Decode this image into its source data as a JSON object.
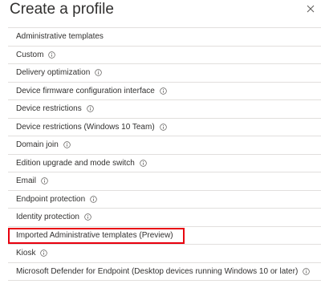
{
  "header": {
    "title": "Create a profile"
  },
  "items": [
    {
      "label": "Administrative templates",
      "info": false,
      "highlighted": false
    },
    {
      "label": "Custom",
      "info": true,
      "highlighted": false
    },
    {
      "label": "Delivery optimization",
      "info": true,
      "highlighted": false
    },
    {
      "label": "Device firmware configuration interface",
      "info": true,
      "highlighted": false
    },
    {
      "label": "Device restrictions",
      "info": true,
      "highlighted": false
    },
    {
      "label": "Device restrictions (Windows 10 Team)",
      "info": true,
      "highlighted": false
    },
    {
      "label": "Domain join",
      "info": true,
      "highlighted": false
    },
    {
      "label": "Edition upgrade and mode switch",
      "info": true,
      "highlighted": false
    },
    {
      "label": "Email",
      "info": true,
      "highlighted": false
    },
    {
      "label": "Endpoint protection",
      "info": true,
      "highlighted": false
    },
    {
      "label": "Identity protection",
      "info": true,
      "highlighted": false
    },
    {
      "label": "Imported Administrative templates (Preview)",
      "info": false,
      "highlighted": true
    },
    {
      "label": "Kiosk",
      "info": true,
      "highlighted": false
    },
    {
      "label": "Microsoft Defender for Endpoint (Desktop devices running Windows 10 or later)",
      "info": true,
      "highlighted": false
    }
  ],
  "colors": {
    "highlight": "#e8000e",
    "divider": "#e1dfdd",
    "text": "#323130"
  },
  "icons": {
    "close": "close-icon",
    "info": "info-icon"
  }
}
